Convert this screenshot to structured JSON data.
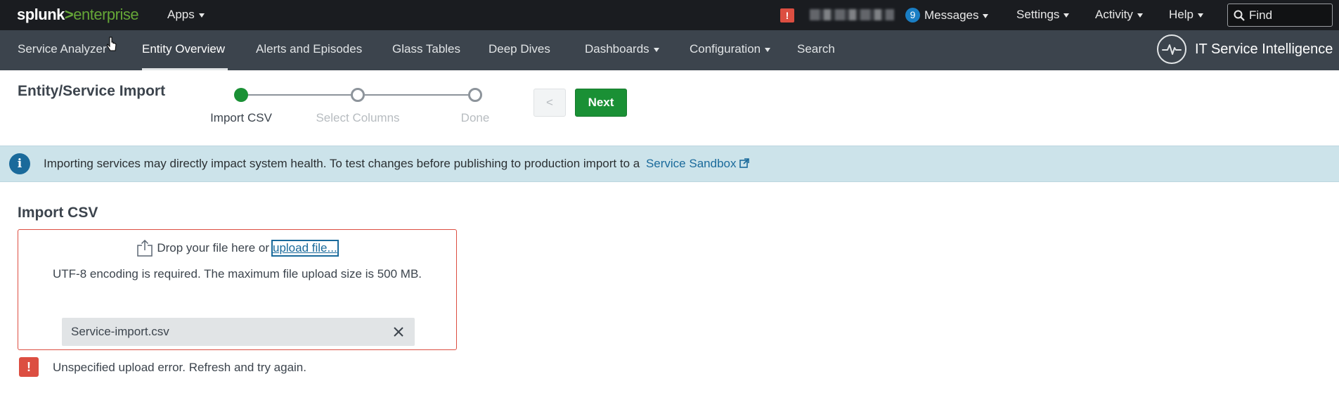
{
  "topbar": {
    "logo_main": "splunk",
    "logo_gt": ">",
    "logo_sub": "enterprise",
    "apps_label": "Apps",
    "alert_badge": "!",
    "messages_count": "9",
    "messages_label": "Messages",
    "settings_label": "Settings",
    "activity_label": "Activity",
    "help_label": "Help",
    "find_placeholder": "Find"
  },
  "appbar": {
    "nav": [
      {
        "label": "Service Analyzer"
      },
      {
        "label": "Entity Overview"
      },
      {
        "label": "Alerts and Episodes"
      },
      {
        "label": "Glass Tables"
      },
      {
        "label": "Deep Dives"
      },
      {
        "label": "Dashboards"
      },
      {
        "label": "Configuration"
      },
      {
        "label": "Search"
      }
    ],
    "app_title": "IT Service Intelligence"
  },
  "wizard": {
    "title": "Entity/Service Import",
    "steps": [
      {
        "label": "Import CSV"
      },
      {
        "label": "Select Columns"
      },
      {
        "label": "Done"
      }
    ],
    "prev_label": "<",
    "next_label": "Next"
  },
  "banner": {
    "text": "Importing services may directly impact system health. To test changes before publishing to production import to a",
    "link_label": "Service Sandbox"
  },
  "import": {
    "title": "Import CSV",
    "drop_text": "Drop your file here or",
    "upload_link": "upload file...",
    "note": "UTF-8 encoding is required. The maximum file upload size is 500 MB.",
    "file_name": "Service-import.csv",
    "error_icon": "!",
    "error_text": "Unspecified upload error. Refresh and try again."
  },
  "colors": {
    "topbar_bg": "#1a1c20",
    "appbar_bg": "#3c444d",
    "primary_green": "#1a9035",
    "link_blue": "#1a6a9b",
    "error_red": "#dc4e41",
    "banner_bg": "#cce3ea"
  }
}
